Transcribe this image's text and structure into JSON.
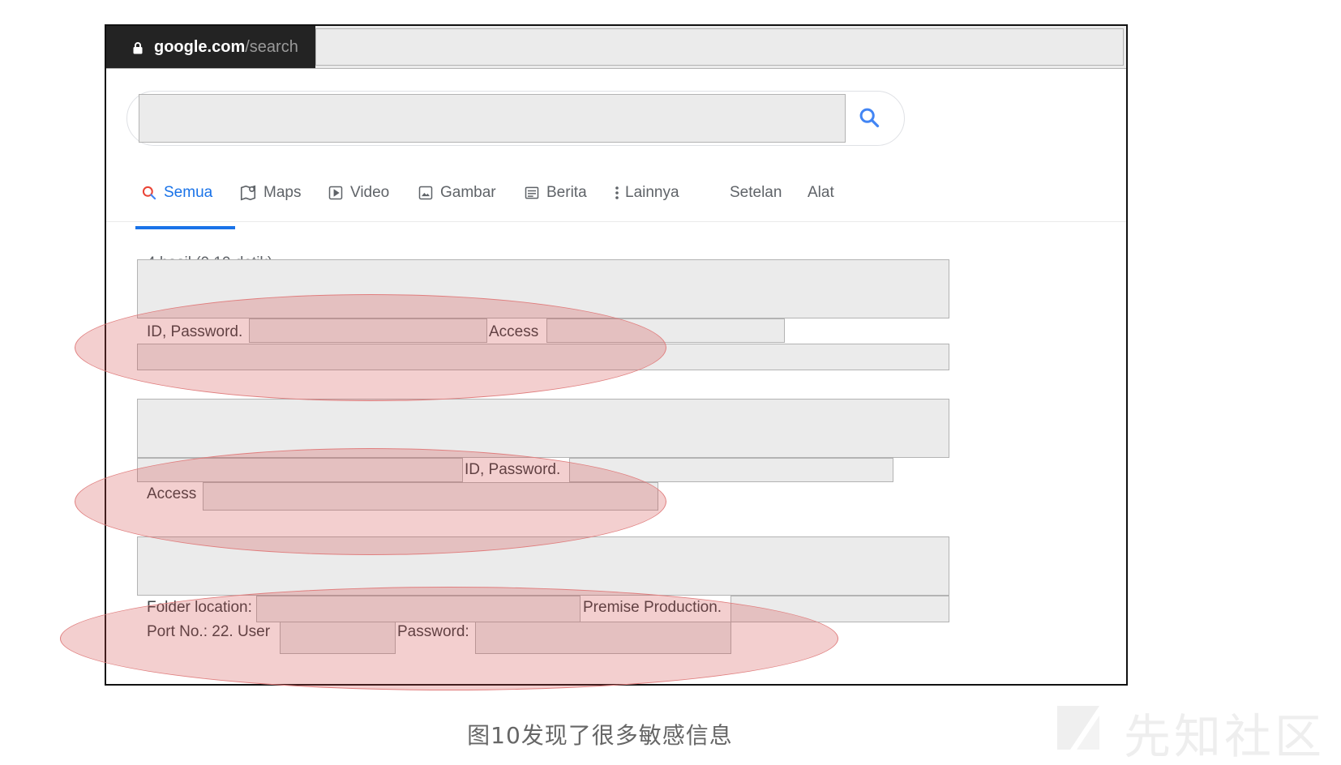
{
  "browser": {
    "url_domain": "google.com",
    "url_path": "/search"
  },
  "tabs": [
    {
      "label": "Semua",
      "icon": "search-icon",
      "active": true
    },
    {
      "label": "Maps",
      "icon": "map-icon"
    },
    {
      "label": "Video",
      "icon": "play-icon"
    },
    {
      "label": "Gambar",
      "icon": "image-icon"
    },
    {
      "label": "Berita",
      "icon": "news-icon"
    },
    {
      "label": "Lainnya",
      "icon": "more-vert-icon"
    },
    {
      "label": "Setelan"
    },
    {
      "label": "Alat"
    }
  ],
  "result_stats": "4 hasil (0,19 detik)",
  "results": [
    {
      "line1": [
        "ID, Password.",
        "Access"
      ]
    },
    {
      "line1": [
        "ID, Password."
      ],
      "line2": [
        "Access"
      ]
    },
    {
      "line1": [
        "Folder location:",
        "Premise Production."
      ],
      "line2": [
        "Port No.: 22. User",
        "Password:"
      ]
    }
  ],
  "caption": "图10发现了很多敏感信息",
  "watermark": "先知社区",
  "colors": {
    "accent": "#1a73e8",
    "highlight": "#d24646",
    "redaction": "#ebebeb"
  }
}
